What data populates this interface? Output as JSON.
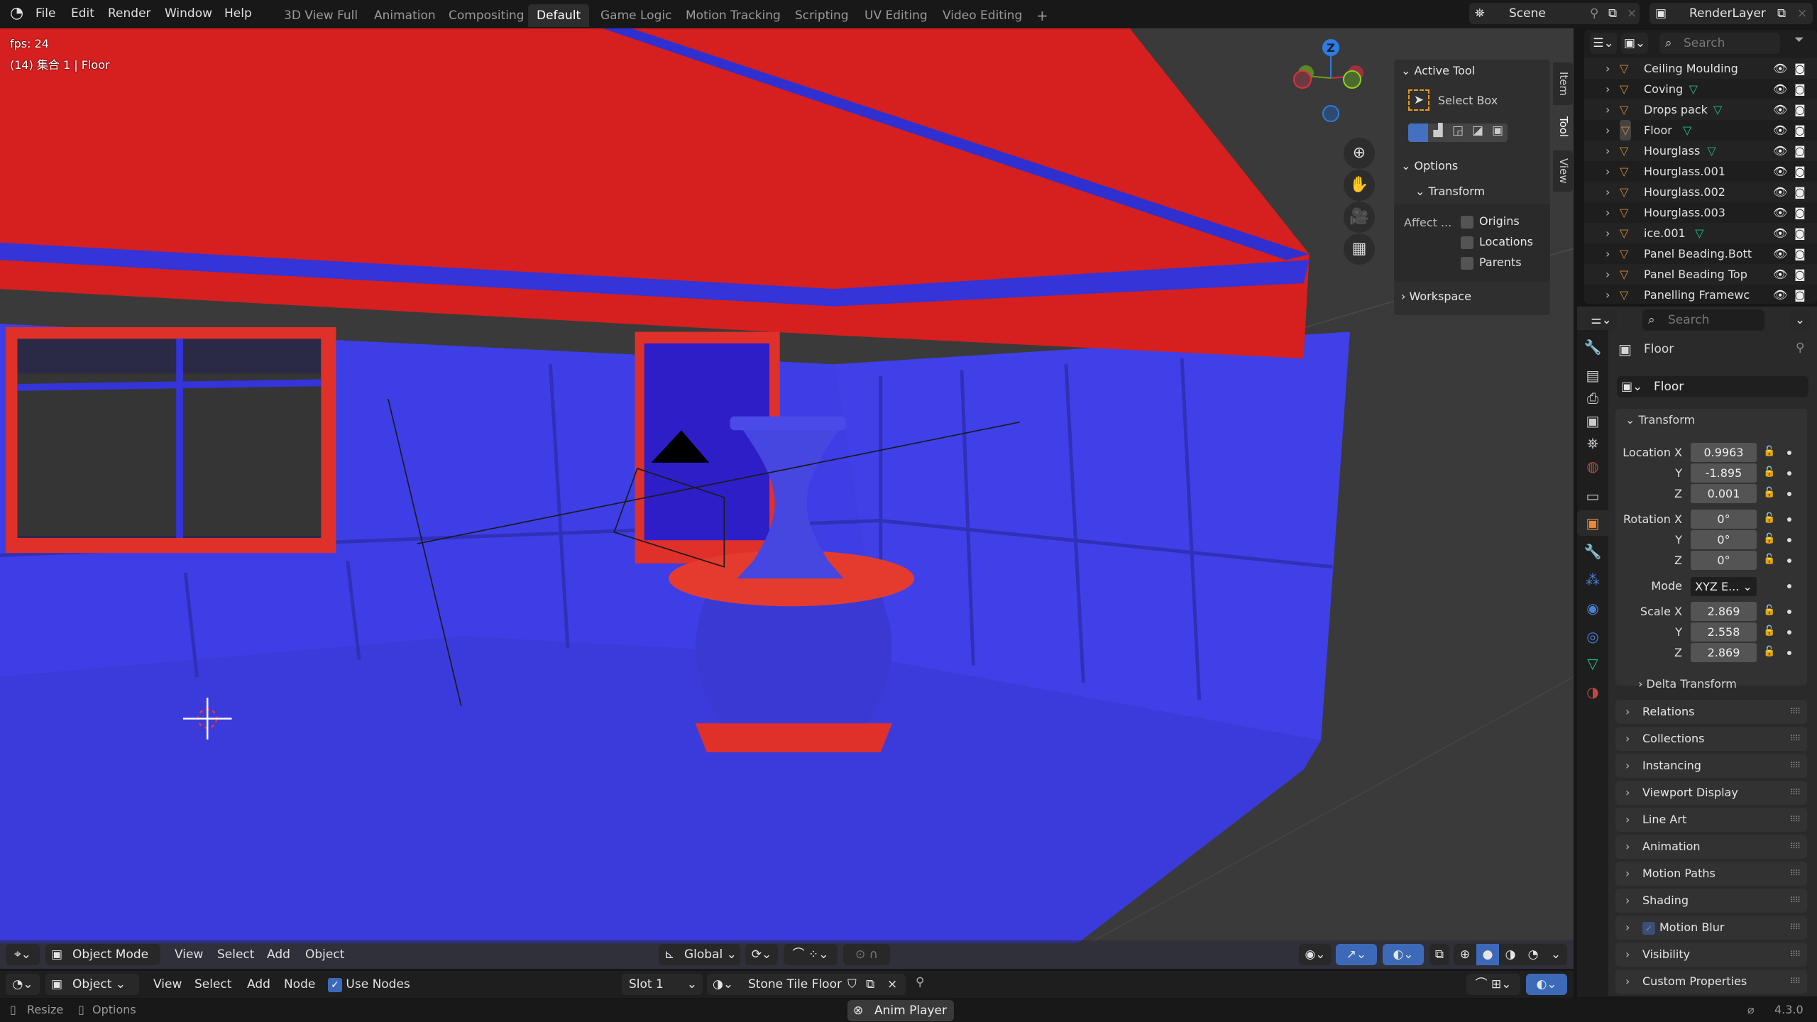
{
  "app": {
    "logo_icon": "blender-logo"
  },
  "menu": [
    "File",
    "Edit",
    "Render",
    "Window",
    "Help"
  ],
  "workspaces": [
    {
      "label": "3D View Full"
    },
    {
      "label": "Animation"
    },
    {
      "label": "Compositing"
    },
    {
      "label": "Default",
      "active": true
    },
    {
      "label": "Game Logic"
    },
    {
      "label": "Motion Tracking"
    },
    {
      "label": "Scripting"
    },
    {
      "label": "UV Editing"
    },
    {
      "label": "Video Editing"
    }
  ],
  "add_workspace": "+",
  "scene": {
    "name": "Scene",
    "view_layer": "RenderLayer"
  },
  "viewport": {
    "fps": "fps: 24",
    "info": "(14) 集合 1 | Floor",
    "gizmo_z": "Z",
    "colors": {
      "ceiling": "#d61f1f",
      "walls": "#3c3ce4",
      "floor": "#3b3bdc",
      "background": "#3a3a3a"
    }
  },
  "npanel": {
    "tabs": [
      "Item",
      "Tool",
      "View"
    ],
    "active_tool": "Active Tool",
    "select_box": "Select Box",
    "options": "Options",
    "transform": "Transform",
    "affect": "Affect ...",
    "checks": [
      "Origins",
      "Locations",
      "Parents"
    ],
    "workspace": "Workspace"
  },
  "outliner": {
    "search_placeholder": "Search",
    "items": [
      {
        "name": "Ceiling Moulding",
        "mesh": false
      },
      {
        "name": "Coving",
        "mesh": true
      },
      {
        "name": "Drops pack",
        "mesh": true
      },
      {
        "name": "Floor",
        "mesh": true,
        "active": true
      },
      {
        "name": "Hourglass",
        "mesh": true
      },
      {
        "name": "Hourglass.001",
        "mesh": false
      },
      {
        "name": "Hourglass.002",
        "mesh": false
      },
      {
        "name": "Hourglass.003",
        "mesh": false
      },
      {
        "name": "ice.001",
        "mesh": true
      },
      {
        "name": "Panel Beading.Bott",
        "mesh": false
      },
      {
        "name": "Panel Beading Top",
        "mesh": false
      },
      {
        "name": "Panelling Framewc",
        "mesh": false
      }
    ]
  },
  "properties": {
    "search_placeholder": "Search",
    "object_name": "Floor",
    "datablock": "Floor",
    "transform": "Transform",
    "rows": [
      {
        "label": "Location X",
        "value": "0.9963"
      },
      {
        "label": "Y",
        "value": "-1.895"
      },
      {
        "label": "Z",
        "value": "0.001"
      },
      {
        "label": "Rotation X",
        "value": "0°"
      },
      {
        "label": "Y",
        "value": "0°"
      },
      {
        "label": "Z",
        "value": "0°"
      }
    ],
    "mode_label": "Mode",
    "mode_value": "XYZ E...",
    "scale": [
      {
        "label": "Scale X",
        "value": "2.869"
      },
      {
        "label": "Y",
        "value": "2.558"
      },
      {
        "label": "Z",
        "value": "2.869"
      }
    ],
    "delta": "Delta Transform",
    "panels": [
      "Relations",
      "Collections",
      "Instancing",
      "Viewport Display",
      "Line Art",
      "Animation",
      "Motion Paths",
      "Shading",
      "Motion Blur",
      "Visibility",
      "Custom Properties"
    ]
  },
  "view3d_header": {
    "mode": "Object Mode",
    "menus": [
      "View",
      "Select",
      "Add",
      "Object"
    ],
    "orientation": "Global"
  },
  "shader_header": {
    "type": "Object",
    "menus": [
      "View",
      "Select",
      "Add",
      "Node"
    ],
    "use_nodes": "Use Nodes",
    "slot": "Slot 1",
    "material": "Stone Tile Floor"
  },
  "status": {
    "resize": "Resize",
    "options": "Options",
    "anim_player": "Anim Player",
    "version": "4.3.0"
  }
}
